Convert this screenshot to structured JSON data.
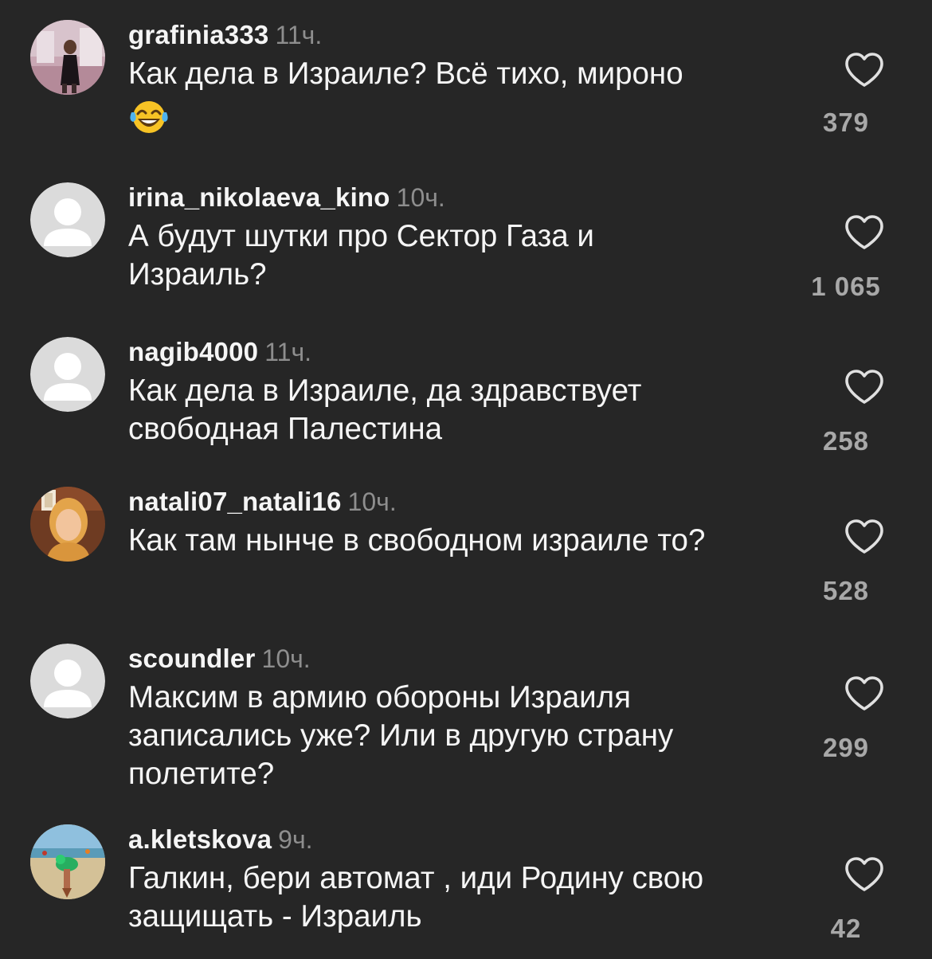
{
  "comments": [
    {
      "username": "grafinia333",
      "time": "11ч.",
      "text": "Как дела в Израиле? Всё тихо, мироно",
      "emoji": "face-with-tears-of-joy-emoji",
      "likes": "379",
      "avatar": "photo-avatar"
    },
    {
      "username": "irina_nikolaeva_kino",
      "time": "10ч.",
      "text": "А будут шутки про Сектор Газа и Израиль?",
      "likes": "1 065",
      "avatar": "default-avatar"
    },
    {
      "username": "nagib4000",
      "time": "11ч.",
      "text": "Как дела в Израиле, да здравствует свободная Палестина",
      "likes": "258",
      "avatar": "default-avatar"
    },
    {
      "username": "natali07_natali16",
      "time": "10ч.",
      "text": "Как там нынче в свободном израиле то?",
      "likes": "528",
      "avatar": "photo-avatar"
    },
    {
      "username": "scoundler",
      "time": "10ч.",
      "text": "Максим в армию обороны Израиля записались уже? Или в другую страну полетите?",
      "likes": "299",
      "avatar": "default-avatar"
    },
    {
      "username": "a.kletskova",
      "time": "9ч.",
      "text": "Галкин, бери автомат , иди Родину свою защищать - Израиль",
      "likes": "42",
      "avatar": "photo-avatar"
    }
  ],
  "colors": {
    "background": "#262626",
    "text_primary": "#f5f5f5",
    "text_secondary": "#8e8e8e",
    "like_count": "#a8a8a8",
    "heart_stroke": "#e0e0e0",
    "default_avatar_bg": "#dbdbdb"
  }
}
